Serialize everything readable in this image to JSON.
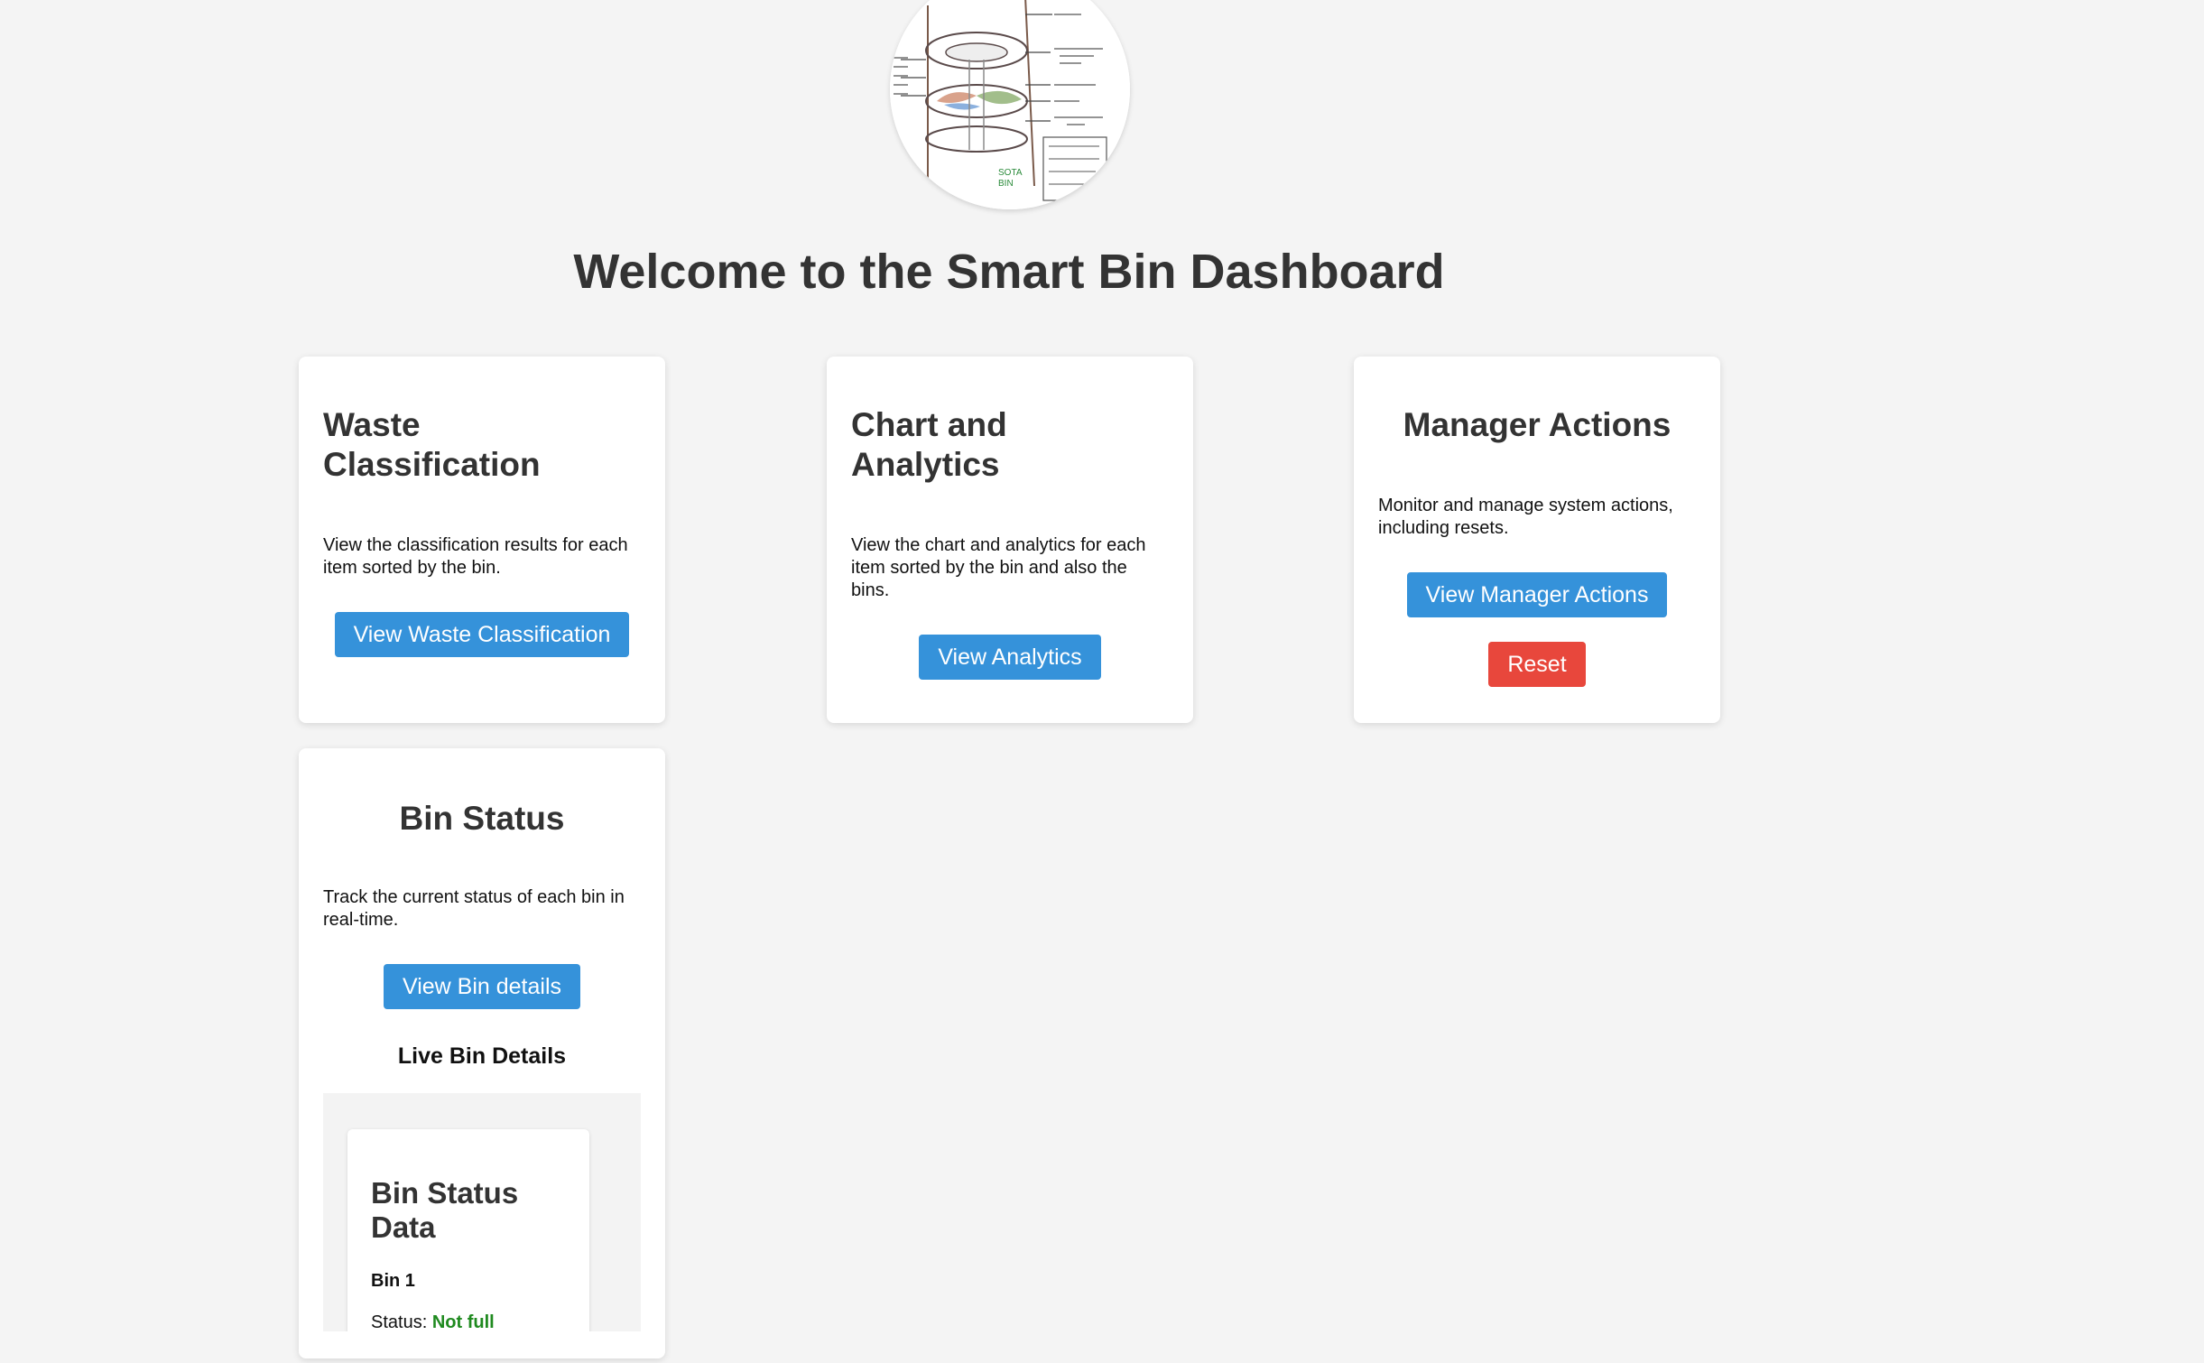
{
  "page": {
    "title": "Welcome to the Smart Bin Dashboard"
  },
  "logo": {
    "icon": "smart-bin-sketch-icon"
  },
  "cards": {
    "waste": {
      "title": "Waste Classification",
      "description": "View the classification results for each item sorted by the bin.",
      "button": "View Waste Classification"
    },
    "analytics": {
      "title": "Chart and Analytics",
      "description": "View the chart and analytics for each item sorted by the bin and also the bins.",
      "button": "View Analytics"
    },
    "manager": {
      "title": "Manager Actions",
      "description": "Monitor and manage system actions, including resets.",
      "button": "View Manager Actions",
      "reset_button": "Reset"
    },
    "bin": {
      "title": "Bin Status",
      "description": "Track the current status of each bin in real-time.",
      "button": "View Bin details",
      "live_title": "Live Bin Details",
      "live": {
        "heading": "Bin Status Data",
        "bin_name": "Bin 1",
        "status_label": "Status:",
        "status_value": "Not full"
      }
    }
  },
  "colors": {
    "background": "#f4f4f4",
    "primary_button": "#3592da",
    "danger_button": "#e8473c",
    "status_ok": "#1f8a1f"
  }
}
